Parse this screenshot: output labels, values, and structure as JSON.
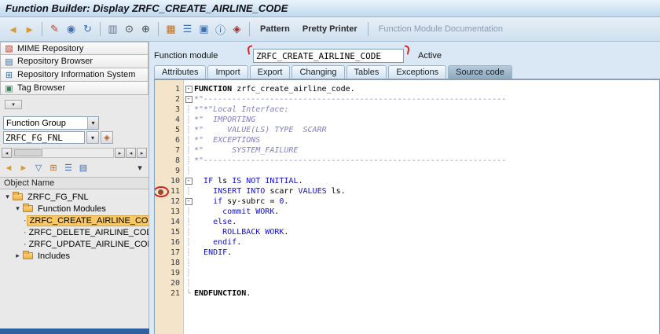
{
  "window": {
    "title": "Function Builder: Display ZRFC_CREATE_AIRLINE_CODE"
  },
  "glyphs": {
    "dropdown": "▾",
    "left_arrow": "◂",
    "right_arrow": "▸",
    "value_help": "◈",
    "bullet": "·",
    "expanded": "▾",
    "collapsed": "▸"
  },
  "annotations": {
    "red_check": "✓"
  },
  "toolbar": {
    "icons": [
      {
        "name": "back-icon",
        "glyph": "◄",
        "color": "#d9992e"
      },
      {
        "name": "forward-icon",
        "glyph": "►",
        "color": "#d9992e"
      },
      {
        "type": "sep"
      },
      {
        "name": "display-change-icon",
        "glyph": "✎",
        "color": "#b04a3a"
      },
      {
        "name": "display-icon",
        "glyph": "◉",
        "color": "#3f6fae"
      },
      {
        "name": "refresh-icon",
        "glyph": "↻",
        "color": "#3f6fae"
      },
      {
        "type": "sep"
      },
      {
        "name": "print-icon",
        "glyph": "▥",
        "color": "#6a7a8a"
      },
      {
        "name": "find-icon",
        "glyph": "⊙",
        "color": "#444444"
      },
      {
        "name": "find-next-icon",
        "glyph": "⊕",
        "color": "#444444"
      },
      {
        "type": "sep"
      },
      {
        "name": "where-used-icon",
        "glyph": "▦",
        "color": "#b07030"
      },
      {
        "name": "object-list-icon",
        "glyph": "☰",
        "color": "#3f6fae"
      },
      {
        "name": "display-object-icon",
        "glyph": "▣",
        "color": "#3f6fae"
      },
      {
        "name": "documentation-icon",
        "glyph": "ⓘ",
        "color": "#2b5fa8"
      },
      {
        "name": "test-icon",
        "glyph": "◈",
        "color": "#9c2f2f"
      }
    ],
    "buttons": [
      {
        "label": "Pattern",
        "enabled": true
      },
      {
        "label": "Pretty Printer",
        "enabled": true
      },
      {
        "label": "Function Module Documentation",
        "enabled": false,
        "sep_before": true
      }
    ]
  },
  "sidebar": {
    "nav_buttons": [
      {
        "label": "MIME Repository",
        "icon": "mime-repository-icon",
        "glyph": "▨",
        "color": "#c0392b"
      },
      {
        "label": "Repository Browser",
        "icon": "repository-browser-icon",
        "glyph": "▤",
        "color": "#2e6da4"
      },
      {
        "label": "Repository Information System",
        "icon": "repository-infosystem-icon",
        "glyph": "⊞",
        "color": "#2e6da4"
      },
      {
        "label": "Tag Browser",
        "icon": "tag-browser-icon",
        "glyph": "▣",
        "color": "#2e8b57"
      }
    ],
    "group_select": {
      "value": "Function Group"
    },
    "object_input": {
      "value": "ZRFC_FG_FNL"
    },
    "tree_toolbar": [
      {
        "name": "previous-object-icon",
        "glyph": "◄",
        "color": "#d9992e"
      },
      {
        "name": "next-object-icon",
        "glyph": "►",
        "color": "#d9992e"
      },
      {
        "name": "filter-icon",
        "glyph": "▽",
        "color": "#3f6fae"
      },
      {
        "name": "where-used-icon",
        "glyph": "⊞",
        "color": "#b07030"
      },
      {
        "name": "worklist-icon",
        "glyph": "☰",
        "color": "#3f6fae"
      },
      {
        "name": "display-list-icon",
        "glyph": "▤",
        "color": "#3f6fae"
      },
      {
        "name": "layout-dropdown-icon",
        "glyph": "▾",
        "color": "#333333",
        "right": true
      }
    ],
    "tree_header": "Object Name",
    "tree": [
      {
        "label": "ZRFC_FG_FNL",
        "level": 0,
        "type": "folder",
        "expanded": true
      },
      {
        "label": "Function Modules",
        "level": 1,
        "type": "folder",
        "expanded": true
      },
      {
        "label": "ZRFC_CREATE_AIRLINE_CODE",
        "level": 2,
        "type": "leaf",
        "selected": true
      },
      {
        "label": "ZRFC_DELETE_AIRLINE_CODE",
        "level": 2,
        "type": "leaf"
      },
      {
        "label": "ZRFC_UPDATE_AIRLINE_CODE",
        "level": 2,
        "type": "leaf",
        "annotation": "red-check"
      },
      {
        "label": "Includes",
        "level": 1,
        "type": "folder",
        "expanded": false
      }
    ]
  },
  "main": {
    "function_module_label": "Function module",
    "function_module_value": "ZRFC_CREATE_AIRLINE_CODE",
    "status_label": "Active",
    "tabs": [
      {
        "label": "Attributes"
      },
      {
        "label": "Import"
      },
      {
        "label": "Export"
      },
      {
        "label": "Changing"
      },
      {
        "label": "Tables"
      },
      {
        "label": "Exceptions"
      },
      {
        "label": "Source code",
        "selected": true
      }
    ]
  },
  "editor": {
    "fold_glyphs": {
      "box": "-",
      "line": "┊",
      "end": "└"
    },
    "lines": [
      {
        "n": 1,
        "fold": "box",
        "seg": [
          [
            "FUNCTION",
            "kb"
          ],
          [
            " zrfc_create_airline_code.",
            "pl"
          ]
        ]
      },
      {
        "n": 2,
        "fold": "box",
        "seg": [
          [
            "*\"----------------------------------------------------------------",
            "cm"
          ]
        ]
      },
      {
        "n": 3,
        "fold": "line",
        "seg": [
          [
            "*\"*\"Local Interface:",
            "cm"
          ]
        ]
      },
      {
        "n": 4,
        "fold": "line",
        "seg": [
          [
            "*\"  IMPORTING",
            "cm"
          ]
        ]
      },
      {
        "n": 5,
        "fold": "line",
        "seg": [
          [
            "*\"     VALUE(LS) TYPE  SCARR",
            "cm"
          ]
        ]
      },
      {
        "n": 6,
        "fold": "line",
        "seg": [
          [
            "*\"  EXCEPTIONS",
            "cm"
          ]
        ]
      },
      {
        "n": 7,
        "fold": "line",
        "seg": [
          [
            "*\"      SYSTEM_FAILURE",
            "cm"
          ]
        ]
      },
      {
        "n": 8,
        "fold": "line",
        "seg": [
          [
            "*\"----------------------------------------------------------------",
            "cm"
          ]
        ]
      },
      {
        "n": 9,
        "fold": "line",
        "seg": []
      },
      {
        "n": 10,
        "fold": "box",
        "seg": [
          [
            "  ",
            "pl"
          ],
          [
            "IF",
            "kw"
          ],
          [
            " ls ",
            "pl"
          ],
          [
            "IS NOT INITIAL",
            "kw"
          ],
          [
            ".",
            "pl"
          ]
        ]
      },
      {
        "n": 11,
        "fold": "line",
        "bp": true,
        "seg": [
          [
            "    ",
            "pl"
          ],
          [
            "INSERT INTO",
            "kw"
          ],
          [
            " scarr ",
            "pl"
          ],
          [
            "VALUES",
            "kw"
          ],
          [
            " ls.",
            "pl"
          ]
        ]
      },
      {
        "n": 12,
        "fold": "box",
        "seg": [
          [
            "    ",
            "pl"
          ],
          [
            "if",
            "kw"
          ],
          [
            " sy-subrc = ",
            "pl"
          ],
          [
            "0",
            "nm"
          ],
          [
            ".",
            "pl"
          ]
        ]
      },
      {
        "n": 13,
        "fold": "line",
        "seg": [
          [
            "      ",
            "pl"
          ],
          [
            "commit WORK",
            "kw"
          ],
          [
            ".",
            "pl"
          ]
        ]
      },
      {
        "n": 14,
        "fold": "line",
        "seg": [
          [
            "    ",
            "pl"
          ],
          [
            "else",
            "kw"
          ],
          [
            ".",
            "pl"
          ]
        ]
      },
      {
        "n": 15,
        "fold": "line",
        "seg": [
          [
            "      ",
            "pl"
          ],
          [
            "ROLLBACK WORK",
            "kw"
          ],
          [
            ".",
            "pl"
          ]
        ]
      },
      {
        "n": 16,
        "fold": "line",
        "seg": [
          [
            "    ",
            "pl"
          ],
          [
            "endif",
            "kw"
          ],
          [
            ".",
            "pl"
          ]
        ]
      },
      {
        "n": 17,
        "fold": "line",
        "seg": [
          [
            "  ",
            "pl"
          ],
          [
            "ENDIF",
            "kw"
          ],
          [
            ".",
            "pl"
          ]
        ]
      },
      {
        "n": 18,
        "fold": "line",
        "seg": []
      },
      {
        "n": 19,
        "fold": "line",
        "seg": []
      },
      {
        "n": 20,
        "fold": "line",
        "seg": []
      },
      {
        "n": 21,
        "fold": "end",
        "seg": [
          [
            "ENDFUNCTION",
            "kb"
          ],
          [
            ".",
            "pl"
          ]
        ]
      }
    ]
  }
}
